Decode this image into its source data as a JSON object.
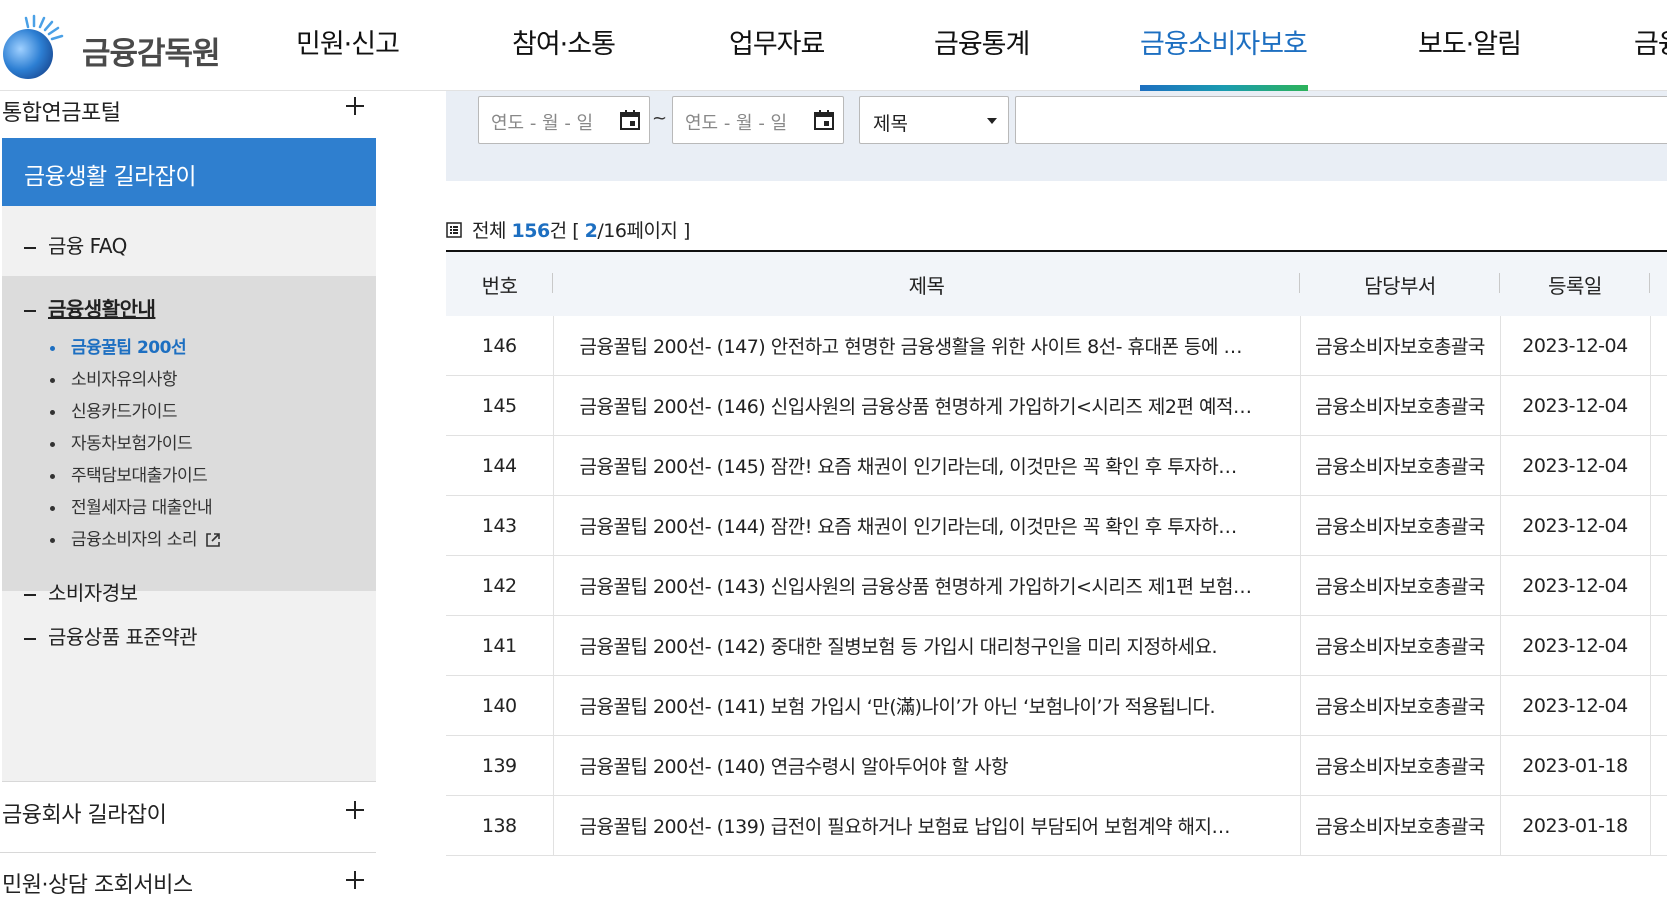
{
  "header": {
    "logo_text": "금융감독원",
    "nav": [
      {
        "label": "민원·신고"
      },
      {
        "label": "참여·소통"
      },
      {
        "label": "업무자료"
      },
      {
        "label": "금융통계"
      },
      {
        "label": "금융소비자보호"
      },
      {
        "label": "보도·알림"
      },
      {
        "label": "금융"
      }
    ],
    "active_nav": "금융소비자보호"
  },
  "sidebar": {
    "top_item": "통합연금포털",
    "section_title": "금융생활 길라잡이",
    "sub_items": [
      {
        "label": "금융 FAQ"
      },
      {
        "label": "금융생활안내"
      },
      {
        "label": "소비자경보"
      },
      {
        "label": "금융상품 표준약관"
      }
    ],
    "leaves": [
      {
        "label": "금융꿀팁 200선"
      },
      {
        "label": "소비자유의사항"
      },
      {
        "label": "신용카드가이드"
      },
      {
        "label": "자동차보험가이드"
      },
      {
        "label": "주택담보대출가이드"
      },
      {
        "label": "전월세자금 대출안내"
      },
      {
        "label": "금융소비자의 소리"
      }
    ],
    "bottom_items": [
      {
        "label": "금융회사 길라잡이"
      },
      {
        "label": "민원·상담 조회서비스"
      }
    ]
  },
  "search": {
    "date_from_placeholder": "연도 - 월 - 일",
    "date_to_placeholder": "연도 - 월 - 일",
    "tilde": "~",
    "select_value": "제목",
    "keyword_value": ""
  },
  "summary": {
    "prefix": "전체 ",
    "total": "156",
    "unit": "건 [ ",
    "page": "2",
    "pages": "/16페이지 ]"
  },
  "table": {
    "headers": {
      "no": "번호",
      "title": "제목",
      "dept": "담당부서",
      "date": "등록일"
    },
    "rows": [
      {
        "no": "146",
        "title": "금융꿀팁 200선- (147) 안전하고 현명한 금융생활을 위한 사이트 8선- 휴대폰 등에 …",
        "dept": "금융소비자보호총괄국",
        "date": "2023-12-04"
      },
      {
        "no": "145",
        "title": "금융꿀팁 200선- (146) 신입사원의 금융상품 현명하게 가입하기<시리즈 제2편 예적…",
        "dept": "금융소비자보호총괄국",
        "date": "2023-12-04"
      },
      {
        "no": "144",
        "title": "금융꿀팁 200선- (145) 잠깐! 요즘 채권이 인기라는데, 이것만은 꼭 확인 후 투자하…",
        "dept": "금융소비자보호총괄국",
        "date": "2023-12-04"
      },
      {
        "no": "143",
        "title": "금융꿀팁 200선- (144) 잠깐! 요즘 채권이 인기라는데, 이것만은 꼭 확인 후 투자하…",
        "dept": "금융소비자보호총괄국",
        "date": "2023-12-04"
      },
      {
        "no": "142",
        "title": "금융꿀팁 200선- (143) 신입사원의 금융상품 현명하게 가입하기<시리즈 제1편 보험…",
        "dept": "금융소비자보호총괄국",
        "date": "2023-12-04"
      },
      {
        "no": "141",
        "title": "금융꿀팁 200선- (142) 중대한 질병보험 등 가입시 대리청구인을 미리 지정하세요.",
        "dept": "금융소비자보호총괄국",
        "date": "2023-12-04"
      },
      {
        "no": "140",
        "title": "금융꿀팁 200선- (141) 보험 가입시 ‘만(滿)나이’가 아닌 ‘보험나이’가 적용됩니다.",
        "dept": "금융소비자보호총괄국",
        "date": "2023-12-04"
      },
      {
        "no": "139",
        "title": "금융꿀팁 200선- (140) 연금수령시 알아두어야 할 사항",
        "dept": "금융소비자보호총괄국",
        "date": "2023-01-18"
      },
      {
        "no": "138",
        "title": "금융꿀팁 200선- (139) 급전이 필요하거나 보험료 납입이 부담되어 보험계약 해지…",
        "dept": "금융소비자보호총괄국",
        "date": "2023-01-18"
      }
    ]
  },
  "colors": {
    "accent": "#1d6fc1",
    "sidebar_active": "#2f7fcf",
    "nav_bar_start": "#1d6fc1",
    "nav_bar_end": "#2db35a"
  }
}
